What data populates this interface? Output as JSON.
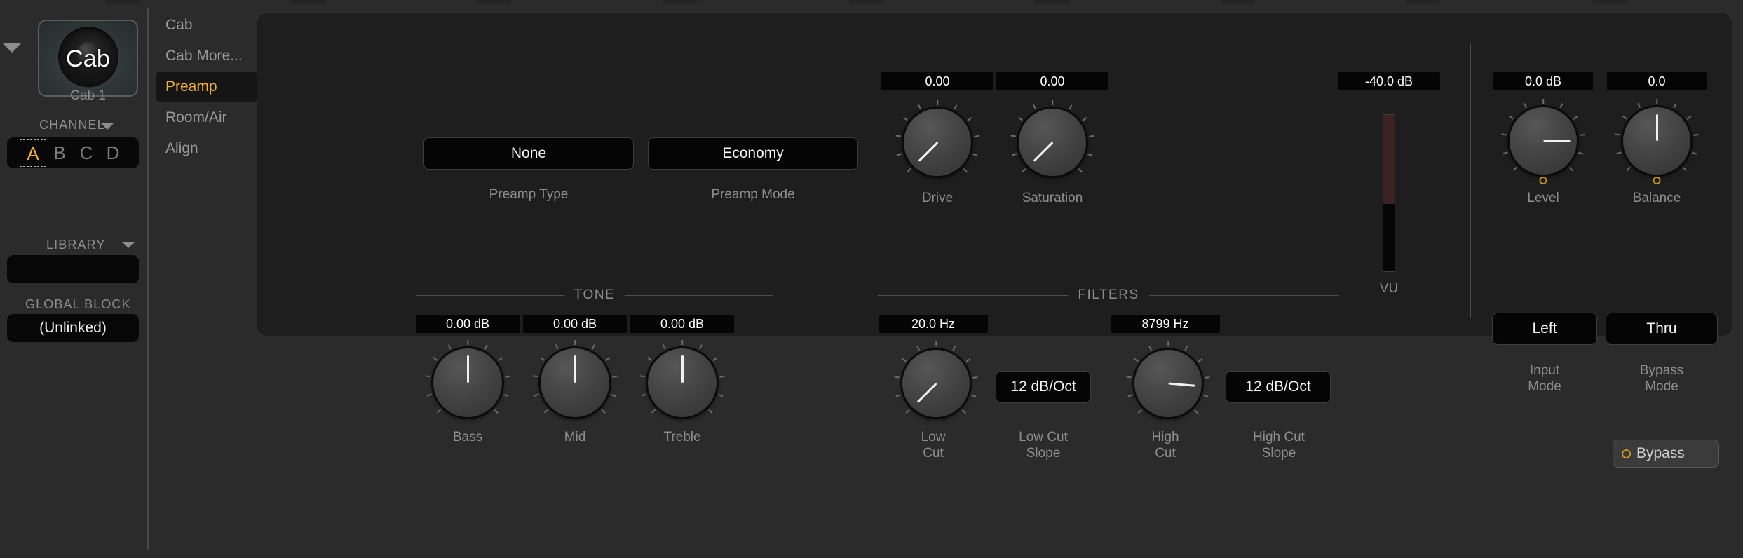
{
  "app": {
    "background_color": "#2b2b2b",
    "panel_color": "#1e1e1e",
    "accent_color": "#f2b230"
  },
  "top_tabs": {
    "count": 10
  },
  "block": {
    "expand_icon": "triangle-down-icon",
    "thumbnail_label": "Cab",
    "thumbnail_icon": "speaker-cab-icon",
    "name": "Cab 1"
  },
  "channel": {
    "header": "CHANNEL",
    "caret_icon": "triangle-down-icon",
    "options": [
      "A",
      "B",
      "C",
      "D"
    ],
    "selected": "A"
  },
  "library": {
    "header": "LIBRARY",
    "caret_icon": "triangle-down-icon",
    "value": ""
  },
  "global_block": {
    "header": "GLOBAL BLOCK",
    "value": "(Unlinked)"
  },
  "nav": {
    "items": [
      {
        "label": "Cab",
        "active": false
      },
      {
        "label": "Cab More...",
        "active": false
      },
      {
        "label": "Preamp",
        "active": true
      },
      {
        "label": "Room/Air",
        "active": false
      },
      {
        "label": "Align",
        "active": false
      }
    ]
  },
  "preamp": {
    "type": {
      "value": "None",
      "label": "Preamp Type"
    },
    "mode": {
      "value": "Economy",
      "label": "Preamp Mode"
    }
  },
  "drive": {
    "value": "0.00",
    "label": "Drive",
    "angle": -135
  },
  "saturation": {
    "value": "0.00",
    "label": "Saturation",
    "angle": -135
  },
  "tone": {
    "header": "TONE",
    "bass": {
      "value": "0.00 dB",
      "label": "Bass",
      "angle": 0
    },
    "mid": {
      "value": "0.00 dB",
      "label": "Mid",
      "angle": 0
    },
    "treble": {
      "value": "0.00 dB",
      "label": "Treble",
      "angle": 0
    }
  },
  "filters": {
    "header": "FILTERS",
    "low_cut": {
      "value": "20.0 Hz",
      "label": "Low\nCut",
      "angle": -135
    },
    "low_cut_slope": {
      "value": "12 dB/Oct",
      "label": "Low Cut\nSlope"
    },
    "high_cut": {
      "value": "8799 Hz",
      "label": "High\nCut",
      "angle": 95
    },
    "high_cut_slope": {
      "value": "12 dB/Oct",
      "label": "High Cut\nSlope"
    }
  },
  "vu": {
    "value": "-40.0 dB",
    "label": "VU",
    "fill_percent": 57,
    "fill_color": "#3b2323"
  },
  "output": {
    "level": {
      "value": "0.0 dB",
      "label": "Level",
      "angle": 90
    },
    "balance": {
      "value": "0.0",
      "label": "Balance",
      "angle": 0
    },
    "input_mode": {
      "value": "Left",
      "label": "Input\nMode"
    },
    "bypass_mode": {
      "value": "Thru",
      "label": "Bypass\nMode"
    },
    "bypass": {
      "label": "Bypass",
      "led_icon": "circle-led-icon",
      "active": false
    }
  }
}
